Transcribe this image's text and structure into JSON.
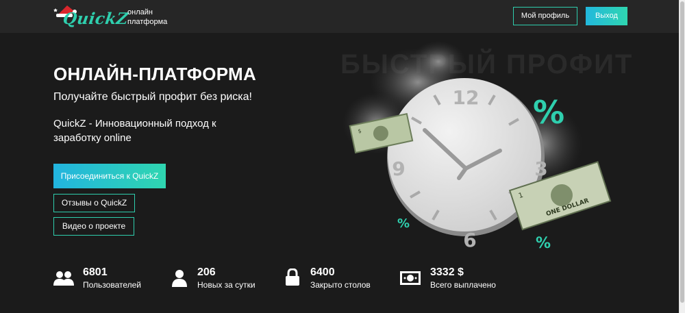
{
  "header": {
    "logo_text": "QuickZ",
    "tagline_line1": "онлайн",
    "tagline_line2": "платформа",
    "profile_button": "Мой профиль",
    "logout_button": "Выход"
  },
  "hero": {
    "title": "ОНЛАЙН-ПЛАТФОРМА",
    "subtitle": "Получайте быстрый профит без риска!",
    "description": "QuickZ - Инновационный подход к заработку online",
    "join_button": "Присоединиться к QuickZ",
    "reviews_button": "Отзывы о QuickZ",
    "video_button": "Видео о проекте",
    "background_word": "БЫСТРЫЙ ПРОФИТ",
    "clock_numbers": [
      "12",
      "3",
      "6",
      "9"
    ],
    "percent_sign": "%"
  },
  "stats": [
    {
      "icon": "users-icon",
      "value": "6801",
      "label": "Пользователей"
    },
    {
      "icon": "user-icon",
      "value": "206",
      "label": "Новых за сутки"
    },
    {
      "icon": "lock-icon",
      "value": "6400",
      "label": "Закрыто столов"
    },
    {
      "icon": "money-icon",
      "value": "3332 $",
      "label": "Всего выплачено"
    }
  ],
  "colors": {
    "accent": "#2fcfae",
    "accent_blue": "#22b8dd",
    "background": "#1b1b1b",
    "header_bg": "#262626"
  }
}
